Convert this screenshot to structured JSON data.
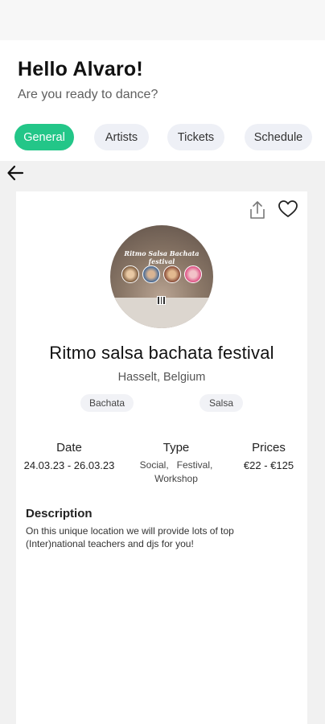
{
  "header": {
    "greeting": "Hello Alvaro!",
    "subtitle": "Are you ready to dance?"
  },
  "tabs": [
    {
      "label": "General",
      "active": true
    },
    {
      "label": "Artists",
      "active": false
    },
    {
      "label": "Tickets",
      "active": false
    },
    {
      "label": "Schedule",
      "active": false
    }
  ],
  "event": {
    "title": "Ritmo salsa bachata festival",
    "location": "Hasselt, Belgium",
    "image_title": "Ritmo Salsa Bachata festival",
    "tags": [
      "Bachata",
      "Salsa"
    ],
    "info": {
      "date_label": "Date",
      "date_value": "24.03.23 - 26.03.23",
      "type_label": "Type",
      "type_value_line1": "Social,   Festival,",
      "type_value_line2": "Workshop",
      "prices_label": "Prices",
      "prices_value": "€22 - €125"
    },
    "description_title": "Description",
    "description_text": "On this unique location we will provide lots of top (Inter)national teachers and djs for you!"
  },
  "icons": {
    "back": "arrow-left-icon",
    "share": "share-icon",
    "like": "heart-icon"
  },
  "colors": {
    "accent": "#23c688",
    "tab_bg": "#eef0f6",
    "content_bg": "#f1f1f1"
  }
}
